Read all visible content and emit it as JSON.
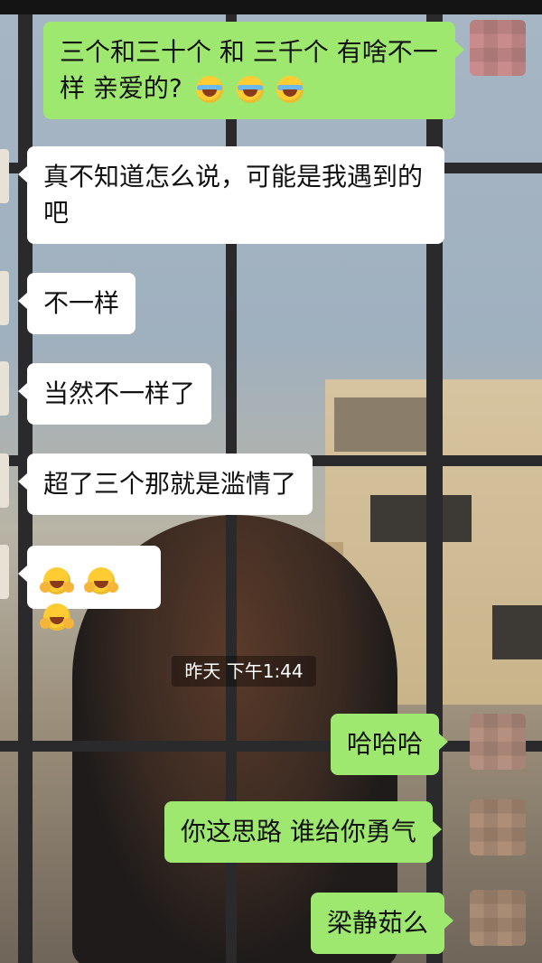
{
  "colors": {
    "outgoing_bubble": "#9fe870",
    "incoming_bubble": "#ffffff",
    "timestamp_bg": "#00000059"
  },
  "messages": [
    {
      "side": "right",
      "text": "三个和三十个 和 三千个 有啥不一样 亲爱的?",
      "emoji": [
        "face-with-tears-of-joy",
        "face-with-tears-of-joy",
        "face-with-tears-of-joy"
      ]
    },
    {
      "side": "left",
      "text": "真不知道怎么说，可能是我遇到的吧"
    },
    {
      "side": "left",
      "text": "不一样"
    },
    {
      "side": "left",
      "text": "当然不一样了"
    },
    {
      "side": "left",
      "text": "超了三个那就是滥情了"
    },
    {
      "side": "left",
      "text": "",
      "emoji": [
        "hugging-face",
        "hugging-face",
        "hugging-face"
      ]
    },
    {
      "side": "right",
      "text": "哈哈哈"
    },
    {
      "side": "right",
      "text": "你这思路 谁给你勇气"
    },
    {
      "side": "right",
      "text": "梁静茹么"
    }
  ],
  "timestamp": "昨天 下午1:44",
  "icons": [
    "avatar-blurred",
    "face-with-tears-of-joy",
    "hugging-face"
  ]
}
